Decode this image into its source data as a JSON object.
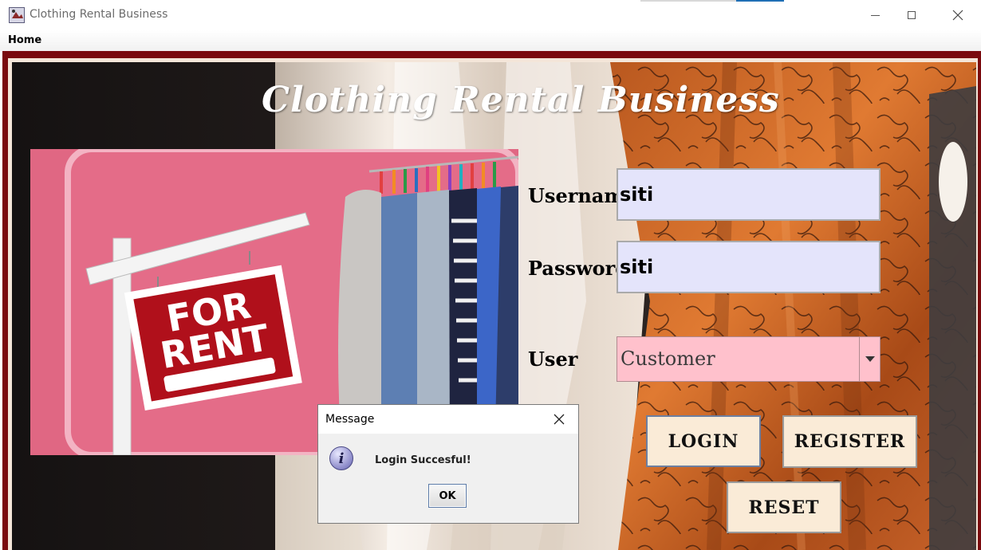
{
  "window": {
    "title": "Clothing Rental Business",
    "icon": "java-app-icon"
  },
  "menubar": {
    "items": [
      {
        "label": "Home"
      }
    ]
  },
  "main": {
    "heading": "Clothing Rental Business",
    "banner": {
      "sign_text_line1": "FOR",
      "sign_text_line2": "RENT"
    },
    "form": {
      "username_label": "Username",
      "username_value": "siti",
      "password_label": "Password",
      "password_value": "siti",
      "user_label": "User",
      "user_selected": "Customer"
    },
    "buttons": {
      "login": "LOGIN",
      "register": "REGISTER",
      "reset": "RESET"
    }
  },
  "dialog": {
    "title": "Message",
    "message": "Login Succesful!",
    "ok_label": "OK",
    "icon": "info-icon"
  },
  "colors": {
    "frame_border": "#7a0a0e",
    "field_bg": "#e4e4fb",
    "combo_bg": "#ffc1cc",
    "button_bg": "#faebd7",
    "banner_pink": "#e06783"
  }
}
